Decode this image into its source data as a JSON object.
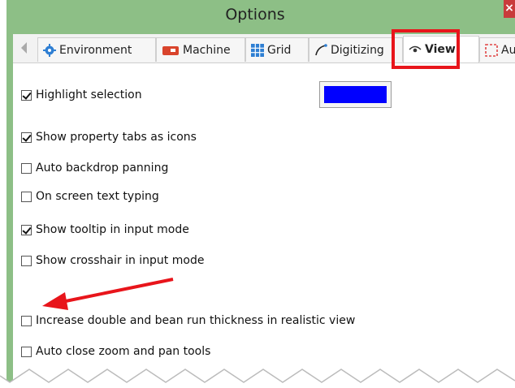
{
  "window": {
    "title": "Options",
    "close_label": "×"
  },
  "tabs": [
    {
      "label": "Environment",
      "icon": "gear-icon"
    },
    {
      "label": "Machine",
      "icon": "machine-icon"
    },
    {
      "label": "Grid",
      "icon": "grid-icon"
    },
    {
      "label": "Digitizing",
      "icon": "digitizing-icon"
    },
    {
      "label": "View",
      "icon": "eye-icon",
      "active": true
    },
    {
      "label": "Au",
      "icon": "dashed-rect-icon"
    }
  ],
  "options": [
    {
      "label": "Highlight selection",
      "checked": true
    },
    {
      "label": "Show property tabs as icons",
      "checked": true
    },
    {
      "label": "Auto backdrop panning",
      "checked": false
    },
    {
      "label": "On screen text typing",
      "checked": false
    },
    {
      "label": "Show tooltip in input mode",
      "checked": true
    },
    {
      "label": "Show crosshair in input mode",
      "checked": false
    },
    {
      "label": "Increase double and bean run thickness in realistic view",
      "checked": false
    },
    {
      "label": "Auto close zoom and pan tools",
      "checked": false
    }
  ],
  "highlight_color": "#0000ff",
  "colors": {
    "titlebar": "#8dbf86",
    "annotation": "#e8151b"
  }
}
